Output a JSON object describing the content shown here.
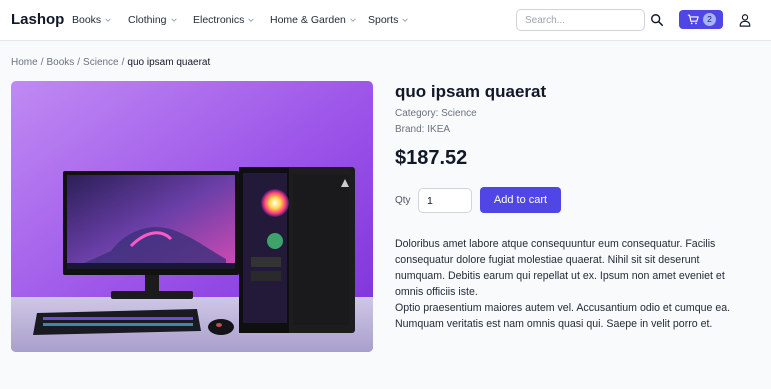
{
  "header": {
    "logo": "Lashop",
    "nav": [
      {
        "label": "Books"
      },
      {
        "label": "Clothing"
      },
      {
        "label": "Electronics"
      },
      {
        "label": "Home & Garden"
      },
      {
        "label": "Sports"
      }
    ],
    "search": {
      "placeholder": "Search...",
      "value": ""
    },
    "cart_count": "2",
    "icons": {
      "search": "search-icon",
      "cart": "cart-icon",
      "user": "user-icon"
    }
  },
  "breadcrumb": {
    "items": [
      "Home",
      "Books",
      "Science"
    ],
    "current": "quo ipsam quaerat",
    "separator": "/"
  },
  "product": {
    "title": "quo ipsam quaerat",
    "category": "Category: Science",
    "brand": "Brand: IKEA",
    "price": "$187.52",
    "qty_label": "Qty",
    "qty_value": "1",
    "add_to_cart": "Add to cart",
    "description": [
      "Doloribus amet labore atque consequuntur eum consequatur. Facilis consequatur dolore fugiat molestiae quaerat. Nihil sit sit deserunt numquam. Debitis earum qui repellat ut ex. Ipsum non amet eveniet et omnis officiis iste.",
      "Optio praesentium maiores autem vel. Accusantium odio et cumque ea. Numquam veritatis est nam omnis quasi qui. Saepe in velit porro et."
    ],
    "image": "desktop-pc-photo"
  },
  "colors": {
    "accent": "#4f46e5",
    "badge": "#a5b4fc",
    "background": "#f9fafb"
  }
}
